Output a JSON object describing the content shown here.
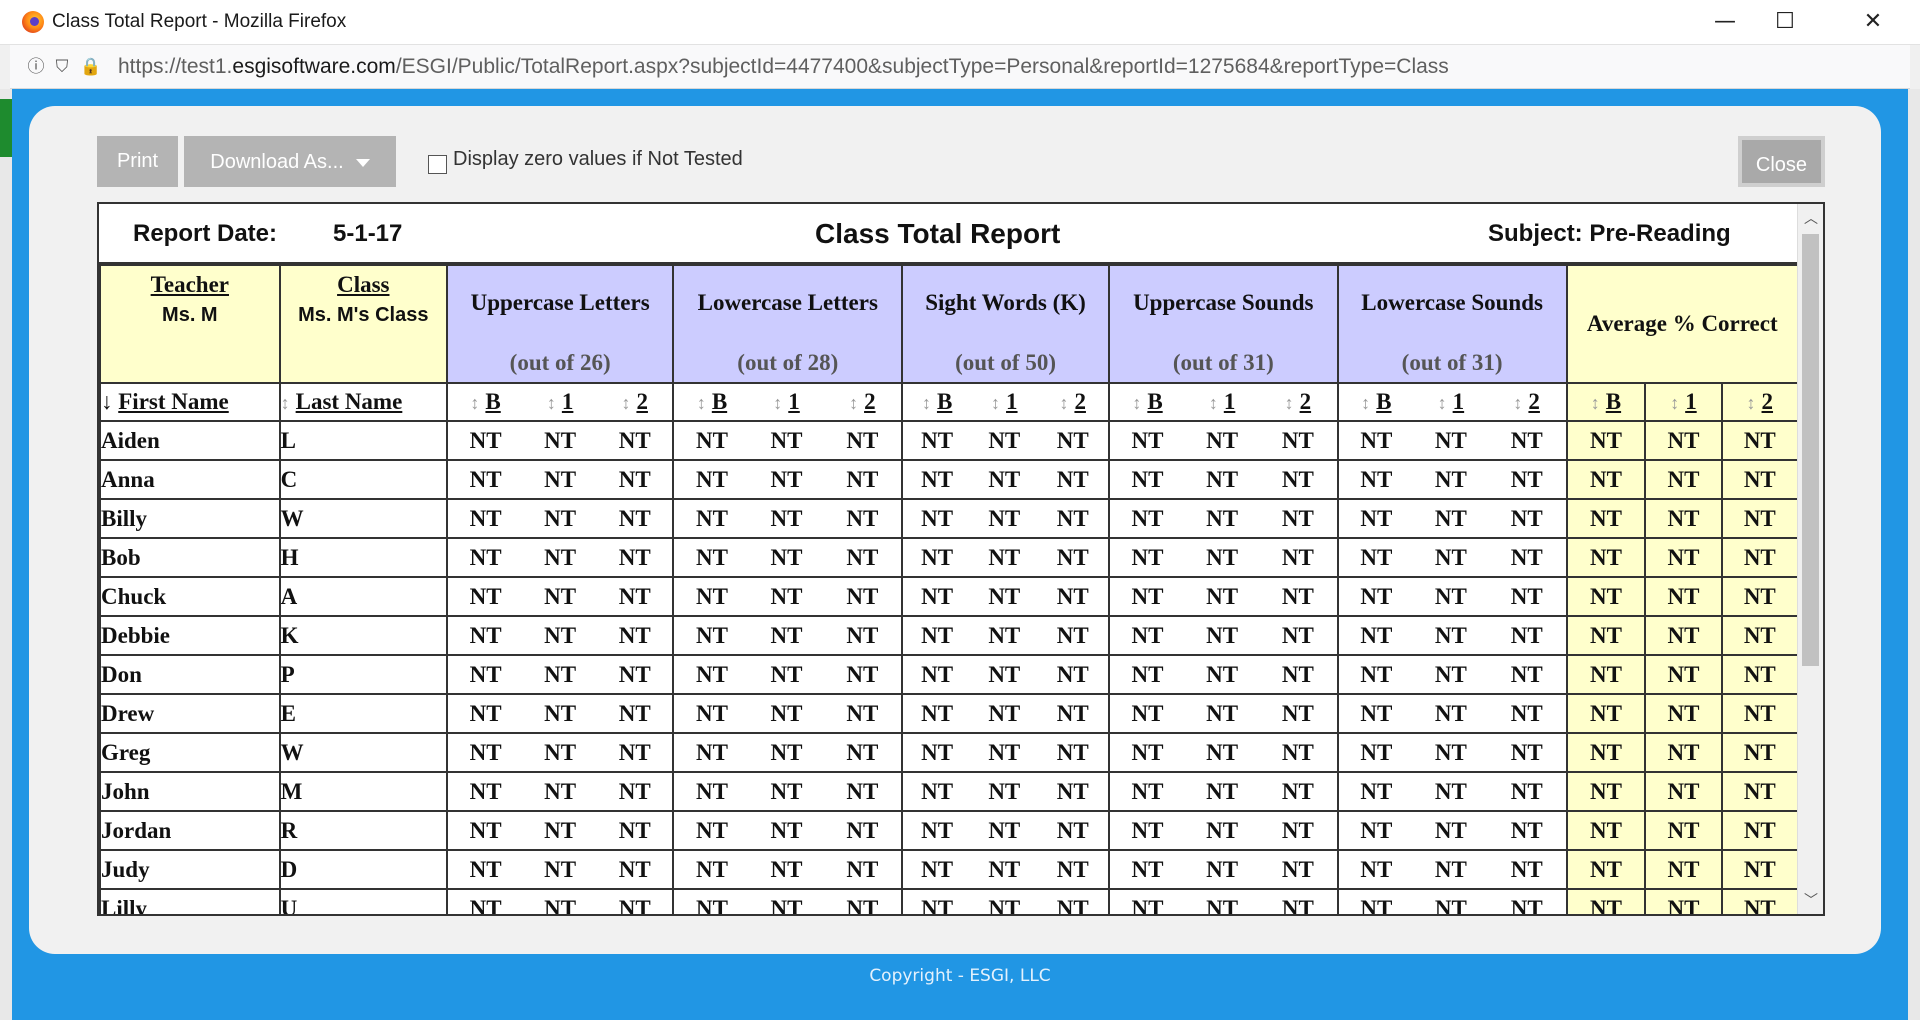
{
  "window": {
    "title": "Class Total Report - Mozilla Firefox",
    "minimize": "—",
    "maximize": "☐",
    "close": "✕"
  },
  "urlbar": {
    "url_prefix": "https://test1.",
    "url_domain": "esgisoftware.com",
    "url_path": "/ESGI/Public/TotalReport.aspx?subjectId=4477400&subjectType=Personal&reportId=1275684&reportType=Class"
  },
  "toolbar": {
    "print_label": "Print",
    "download_label": "Download As...",
    "checkbox_label": "Display zero values if Not Tested",
    "close_label": "Close"
  },
  "report": {
    "date_label": "Report Date:",
    "date_value": "5-1-17",
    "title": "Class Total Report",
    "subject": "Subject: Pre-Reading",
    "teacher_label": "Teacher",
    "teacher_value": "Ms. M",
    "class_label": "Class",
    "class_value": "Ms. M's Class",
    "groups": [
      {
        "name": "Uppercase Letters",
        "sub": "(out of 26)"
      },
      {
        "name": "Lowercase Letters",
        "sub": "(out of 28)"
      },
      {
        "name": "Sight Words (K)",
        "sub": "(out of 50)"
      },
      {
        "name": "Uppercase Sounds",
        "sub": "(out of 31)"
      },
      {
        "name": "Lowercase Sounds",
        "sub": "(out of 31)"
      }
    ],
    "average_label": "Average % Correct",
    "first_name_header": "First Name",
    "last_name_header": "Last Name",
    "sub_columns": [
      "B",
      "1",
      "2"
    ],
    "not_tested": "NT",
    "students": [
      {
        "first": "Aiden",
        "last": "L"
      },
      {
        "first": "Anna",
        "last": "C"
      },
      {
        "first": "Billy",
        "last": "W"
      },
      {
        "first": "Bob",
        "last": "H"
      },
      {
        "first": "Chuck",
        "last": "A"
      },
      {
        "first": "Debbie",
        "last": "K"
      },
      {
        "first": "Don",
        "last": "P"
      },
      {
        "first": "Drew",
        "last": "E"
      },
      {
        "first": "Greg",
        "last": "W"
      },
      {
        "first": "John",
        "last": "M"
      },
      {
        "first": "Jordan",
        "last": "R"
      },
      {
        "first": "Judy",
        "last": "D"
      },
      {
        "first": "Lilly",
        "last": "U"
      }
    ]
  },
  "footer": {
    "copyright": "Copyright - ESGI, LLC"
  },
  "colors": {
    "modal_bg": "#2196e4",
    "group_header": "#ccccff",
    "yellow": "#ffffcc"
  }
}
